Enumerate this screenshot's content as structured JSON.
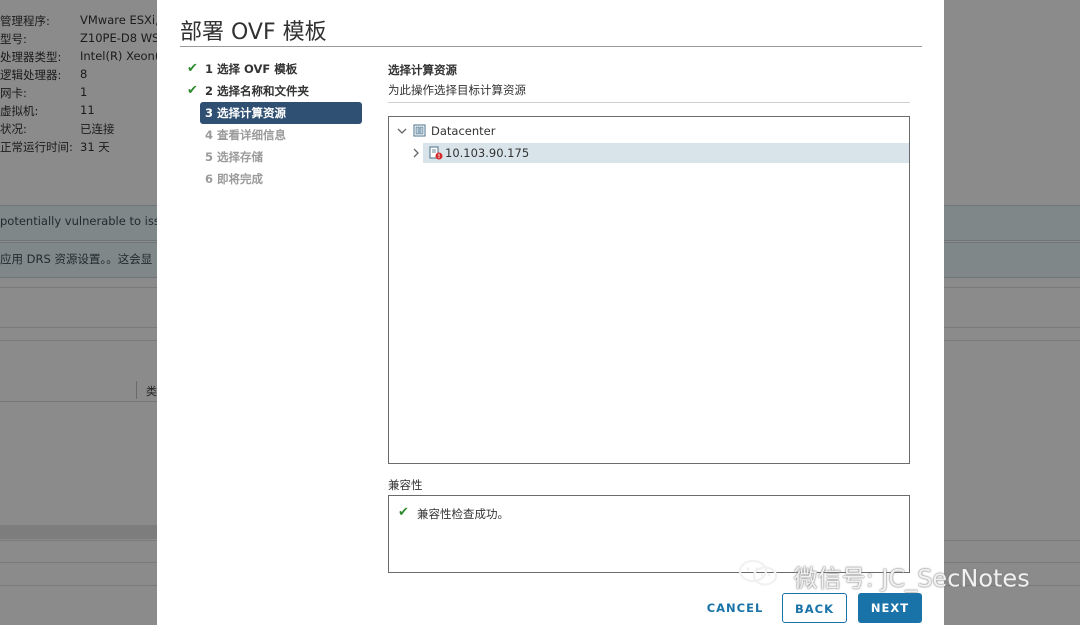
{
  "background": {
    "info": [
      {
        "k": "管理程序:",
        "v": "VMware ESXi,"
      },
      {
        "k": "型号:",
        "v": "Z10PE-D8 WS"
      },
      {
        "k": "处理器类型:",
        "v": "Intel(R) Xeon("
      },
      {
        "k": "逻辑处理器:",
        "v": "8"
      },
      {
        "k": "网卡:",
        "v": "1"
      },
      {
        "k": "虚拟机:",
        "v": "11"
      },
      {
        "k": "状况:",
        "v": "已连接"
      },
      {
        "k": "正常运行时间:",
        "v": "31 天"
      }
    ],
    "alert1": "potentially vulnerable to issue",
    "alert2": "应用 DRS 资源设置。。这会显",
    "table_header": "类"
  },
  "modal": {
    "title": "部署 OVF 模板",
    "steps": [
      {
        "label": "1 选择 OVF 模板",
        "status": "done"
      },
      {
        "label": "2 选择名称和文件夹",
        "status": "done"
      },
      {
        "label": "3 选择计算资源",
        "status": "active"
      },
      {
        "label": "4 查看详细信息",
        "status": "todo"
      },
      {
        "label": "5 选择存储",
        "status": "todo"
      },
      {
        "label": "6 即将完成",
        "status": "todo"
      }
    ],
    "section_title": "选择计算资源",
    "section_desc": "为此操作选择目标计算资源",
    "tree": {
      "datacenter": "Datacenter",
      "host": "10.103.90.175"
    },
    "compat_title": "兼容性",
    "compat_msg": "兼容性检查成功。",
    "buttons": {
      "cancel": "CANCEL",
      "back": "BACK",
      "next": "NEXT"
    },
    "colors": {
      "accent": "#1a73a8",
      "active_step": "#2f4f73",
      "success": "#2e8b2e",
      "error": "#d62b2b"
    }
  },
  "watermark": "微信号: JC_SecNotes"
}
